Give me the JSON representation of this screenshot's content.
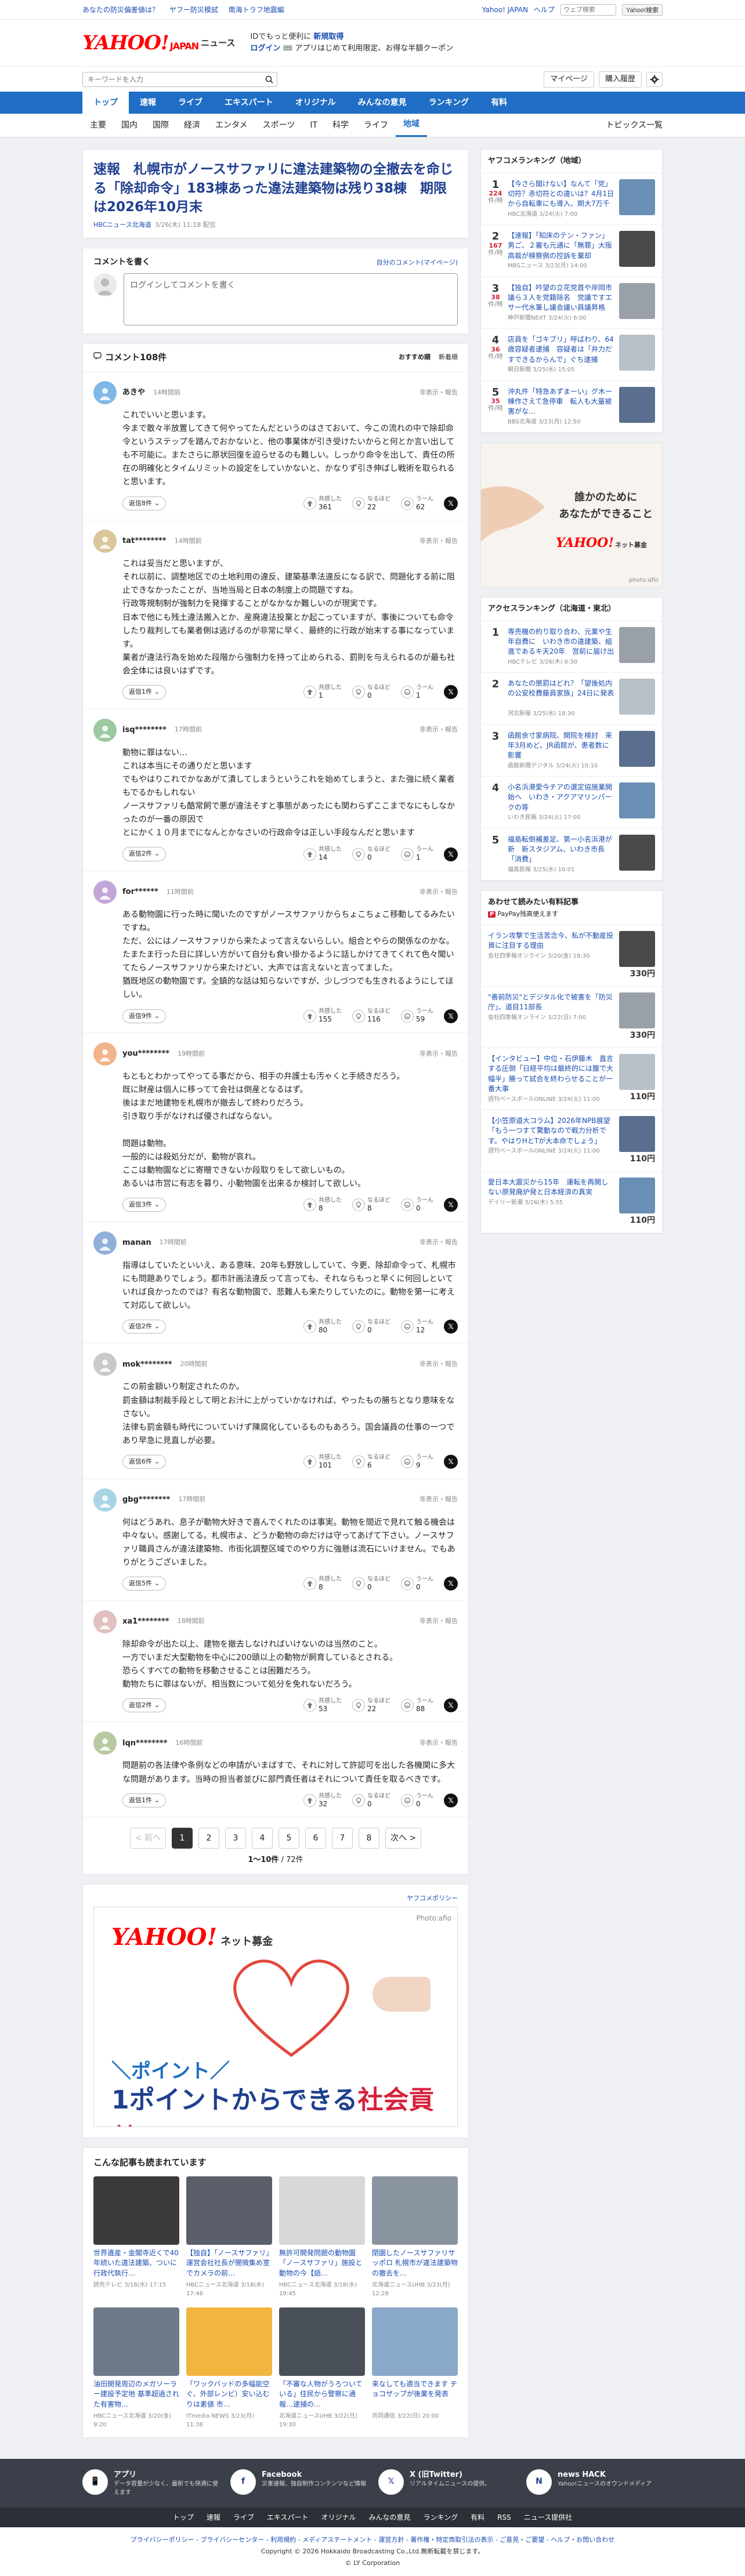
{
  "topstrip": {
    "links": [
      "あなたの防災偏差値は？",
      "ヤフー防災模試",
      "南海トラフ地震編"
    ],
    "right": [
      "Yahoo! JAPAN",
      "ヘルプ"
    ],
    "search_placeholder": "ウェブ検索",
    "search_button": "Yahoo!検索"
  },
  "header": {
    "logo": "YAHOO!",
    "logo_sub": "JAPAN",
    "service": "ニュース",
    "promo1a": "IDでもっと便利に",
    "promo1b": "新規取得",
    "promo2a": "ログイン",
    "promo2b": "アプリはじめて利用限定、お得な半額クーポン"
  },
  "searchrow": {
    "placeholder": "キーワードを入力",
    "mypage": "マイページ",
    "purchase": "購入履歴"
  },
  "nav1": [
    "トップ",
    "速報",
    "ライブ",
    "エキスパート",
    "オリジナル",
    "みんなの意見",
    "ランキング",
    "有料"
  ],
  "nav2": [
    "主要",
    "国内",
    "国際",
    "経済",
    "エンタメ",
    "スポーツ",
    "IT",
    "科学",
    "ライフ",
    "地域"
  ],
  "nav2_topics": "トピックス一覧",
  "article": {
    "title": "速報　札幌市がノースサファリに違法建築物の全撤去を命じる「除却命令」183棟あった違法建築物は残り38棟　期限は2026年10月末",
    "source": "HBCニュース北海道",
    "date": "3/26(木) 11:18 配信"
  },
  "comment_write": {
    "title": "コメントを書く",
    "profile_link": "自分のコメント(マイページ)",
    "box_text": "ログインしてコメントを書く"
  },
  "comments_head": {
    "title": "コメント108件",
    "sort1": "おすすめ順",
    "sort2": "新着順"
  },
  "reply_label": "返信",
  "report_label": "非表示・報告",
  "react_labels": [
    "共感した",
    "なるほど",
    "うーん"
  ],
  "comments": [
    {
      "user": "あきや",
      "time": "14時間前",
      "body": "これでいいと思います。\n今まで散々半放置してきて何やってたんだというのはさておいて、今この流れの中で除却命令というステップを踏んでおかないと、他の事業体が引き受けたいからと何とか言い出しても不可能に。またさらに原状回復を迫らせるのも難しい。しっかり命令を出して、責任の所在の明確化とタイムリミットの設定をしていかないと、かなりず引き伸ばし戦術を取られると思います。",
      "replies": "返信8件",
      "r": [
        361,
        22,
        62
      ]
    },
    {
      "user": "tat********",
      "time": "14時間前",
      "body": "これは妥当だと思いますが、\nそれ以前に、調整地区での土地利用の違反、建築基準法違反になる訳で、問題化する前に阻止できなかったことが、当地当局と日本の制度上の問題ですね。\n行政等規制制が強制力を発揮することがなかなか難しいのが現実です。\n日本で他にも残土違法搬入とか、産廃違法投棄とか起こっていますが、事後についても命令したり裁判しても業者側は逃げるのが非常に早く、最終的に行政が始末する事になっています。\n業者が違法行為を始めた段階から強制力を持って止められる、罰則を与えられるのが最も社会全体には良いはずです。",
      "replies": "返信1件",
      "r": [
        1,
        0,
        1
      ]
    },
    {
      "user": "isq********",
      "time": "17時間前",
      "body": "動物に罪はない…\nこれは本当にその通りだと思います\nでもやはりこれでかなあがて潰してしまうというこれを始めてしまうと、また強に続く業者もでるかもしれない\nノースサファリも酷常飼で悪が違法そすと事態があったにも関わらずここまでなにもしなかったのが一番の原因で\nとにかく１０月までになんとかなさいの行政命令は正しい手段なんだと思います",
      "replies": "返信2件",
      "r": [
        14,
        0,
        1
      ]
    },
    {
      "user": "for******",
      "time": "11時間前",
      "body": "ある動物園に行った時に聞いたのですがノースサファリからちょこちょこ移動してるみたいですね。\nただ、公にはノースサファリから来たよって言えないらしい。組合とやらの関係なのかな。\nたまたま行った日に詳しい方がいて自分も食い掛かるように話しかけてきてくれて色々聞いてたらノースサファリから来たけどい、大声では言えないと言ってました。\n猶既地区の動物園です。全鎮的な話は知らないですが、少しづつでも生きれるようにしてほしい。",
      "replies": "返信9件",
      "r": [
        155,
        116,
        59
      ]
    },
    {
      "user": "you********",
      "time": "19時間前",
      "body": "もともとわかってやってる事だから、相手の弁護士も汚ゃくと手続きだろう。\n既に財産は個人に移ってて会社は倒産となるはず。\n後はまだ地建物を札幌市が撤去して終わりだろう。\n引き取り手がなければ優さればならない。\n\n問題は動物。\n一般的には殺処分だが、動物が哀れ。\nここは動物園などに寄贈できないか段取りをして欲しいもの。\nあるいは市営に有志を募り、小動物園を出来るか検討して欲しい。",
      "replies": "返信3件",
      "r": [
        8,
        8,
        0
      ]
    },
    {
      "user": "manan",
      "time": "17時間前",
      "body": "指導はしていたといいえ、ある意味、20年も野放ししていて、今更、除却命令って、札幌市にも問題ありでしょう。都市計画法違反って言っても、それならもっと早くに何回しといていれば良かったのでは？有名な動物園で、悲難人も来たりしていたのに。動物を第一に考えて対応して欲しい。",
      "replies": "返信2件",
      "r": [
        80,
        0,
        12
      ]
    },
    {
      "user": "mok********",
      "time": "20時間前",
      "body": "この前金額いり制定されたのか。\n罰金額は制裁手段として明とお汁に上がっていかなければ、やったもの勝ちとなり意味をなさない。\n法律も罰金額も時代についていけず陳腐化しているものもあろう。国会議員の仕事の一つであり早急に見直しが必要。",
      "replies": "返信6件",
      "r": [
        101,
        6,
        9
      ]
    },
    {
      "user": "gbg********",
      "time": "17時間前",
      "body": "何はどうあれ、息子が動物大好きで喜んでくれたのは事実。動物を間近で見れて触る機会は中々ない。感謝してる。札幌市よ、どうか動物の命だけは守ってあげて下さい。ノースサファリ職員さんが違法建築物、市街化調整区域でのやり方に強懸は流石にいけません。でもありがとうございました。",
      "replies": "返信5件",
      "r": [
        8,
        0,
        0
      ]
    },
    {
      "user": "xa1********",
      "time": "18時間前",
      "body": "除却命令が出た以上、建物を撤去しなければいけないのは当然のこと。\n一方でいまだ大型動物を中心に200頭以上の動物が飼育しているとされる。\n恐らくすべての動物を移動させることは困難だろう。\n動物たちに罪はないが、相当数について処分を免れないだろう。",
      "replies": "返信2件",
      "r": [
        53,
        22,
        88
      ]
    },
    {
      "user": "lqn********",
      "time": "16時間前",
      "body": "問題前の各法律や条例などの申請がいまばすで、それに対して許認可を出した各機関に多大な問題があります。当時の担当者並びに部門責任者はそれについて責任を取るべきです。",
      "replies": "返信1件",
      "r": [
        32,
        0,
        0
      ]
    }
  ],
  "pager": {
    "prev": "< 前へ",
    "next": "次へ >",
    "pages": [
      "1",
      "2",
      "3",
      "4",
      "5",
      "6",
      "7",
      "8"
    ],
    "count_bold": "1〜10件",
    "count_rest": " / 72件"
  },
  "ad": {
    "policy": "ヤフコメポリシー",
    "logo": "YAHOO!",
    "logo_sub": "JAPAN",
    "logo_tag": "ネット募金",
    "photo": "Photo:afio",
    "line1": "＼ポイント／",
    "line2a": "1ポイントからできる",
    "line2b": "社会貢献"
  },
  "related": {
    "title": "こんな記事も読まれています",
    "items": [
      {
        "t": "世界遺産・金閣寺近くで40年続いた違法建築、ついに行政代執行…",
        "s": "読売テレビ",
        "d": "3/18(水) 17:15"
      },
      {
        "t": "【独自】「ノースサファリ」運営会社社長が闇微集め室でカメラの前…",
        "s": "HBCニュース北海道",
        "d": "3/18(水) 17:46"
      },
      {
        "t": "無許可開発問題の動物園「ノースサファリ」施設と動物の今【語…",
        "s": "HBCニュース北海道",
        "d": "3/18(水) 19:45"
      },
      {
        "t": "閉園したノースサファリサッポロ 札幌市が違法建築物の撤去を…",
        "s": "北海道ニュースUHB",
        "d": "3/23(月) 12:28"
      },
      {
        "t": "油田開発周辺のメガソーラー建設予定地 基準超過された有害物…",
        "s": "HBCニュース北海道",
        "d": "3/20(金) 9:20"
      },
      {
        "t": "「ワックバッドの多幅能空ぐ、外部レンビ）安い込むりは素値 市…",
        "s": "ITmedia NEWS",
        "d": "3/23(月) 11:38"
      },
      {
        "t": "「不審な人物がうろついている」住民から警察に通報…逮捕の…",
        "s": "北海道ニュースUHB",
        "d": "3/22(日) 19:30"
      },
      {
        "t": "来なしても適当できます チョコザップが後業を発表",
        "s": "共同通信",
        "d": "3/22(日) 20:00"
      }
    ]
  },
  "side": {
    "rank_title": "ヤフコメランキング（地域）",
    "rank": [
      {
        "n": "1",
        "c": "224",
        "u": "件/時",
        "t": "【今さら聞けない】なんて「党」切符？赤切符との違いは？4月1日から自転車にも導入、期大7万千円の反則金",
        "s": "HBC北海道 3/24(火) 7:00"
      },
      {
        "n": "2",
        "c": "167",
        "u": "件/時",
        "t": "【速報】「知床のテン・ファン」男ご、２審も元通に「無罪」大阪高裁が検察側の控訴を棄却",
        "s": "MBSニュース 3/23(月) 14:00"
      },
      {
        "n": "3",
        "c": "38",
        "u": "件/時",
        "t": "【独自】吟望の立花党首や岸岡市議ら３人を党籍除名　党議ですエサー代水筆し議会議い員議昇格",
        "s": "神戸新聞NEXT 3/24(火) 6:00"
      },
      {
        "n": "4",
        "c": "36",
        "u": "件/時",
        "t": "店員を「ゴキブリ」呼ばわり、64歳容疑者逮捕　容疑者は「弁力だすできるからんで」ぐち逮捕",
        "s": "朝日新聞 3/25(水) 15:05"
      },
      {
        "n": "5",
        "c": "35",
        "u": "件/時",
        "t": "沖丸件「特急あずまーい」グ木ー棟作さえて急停車　転人も大量被害がな…",
        "s": "BBS北海道 3/23(月) 12:50"
      }
    ],
    "sad_msg1": "誰かのために",
    "sad_msg2": "あなたができること",
    "sad_logo": "YAHOO!",
    "sad_logo_sub": "ネット募金",
    "sad_photo": "photo:afio",
    "access_title": "アクセスランキング（北海道・東北）",
    "access": [
      {
        "n": "1",
        "t": "専売機の約り取り合わ、元業や生年自費に　いわき市の違建築、組進であるキ天20年　営前に届け出定",
        "s": "HBCテレビ 3/26(木) 6:30"
      },
      {
        "n": "2",
        "t": "あなたの懲罰はどれ？「望後処内の公安校費藤員家族」24日に発表",
        "s": "河北新報 3/25(水) 18:30"
      },
      {
        "n": "3",
        "t": "函館余寸家病院、開院を検討　来年3月めど、JR函館が、患者数に影響",
        "s": "函館新聞デジタル 3/24(火) 10:10"
      },
      {
        "n": "4",
        "t": "小名浜港愛今チアの選定協施業開始へ　いわき・アクアマリンパークの等",
        "s": "いわき民報 3/24(火) 17:00"
      },
      {
        "n": "5",
        "t": "福島転倒補差足、第一小名浜港が新　新スタジアム、いわき市長「消費」",
        "s": "福島民報 3/25(水) 10:01"
      }
    ],
    "shop_title": "あわせて読みたい有料記事",
    "shop_pp": "PayPay残高",
    "shop_pp_rest": "使えます",
    "shop": [
      {
        "t": "イラン攻撃で生活苦念今、私が不動産投資に注目する理由",
        "s": "会社四季報オンライン 3/20(金) 18:30",
        "p": "330円"
      },
      {
        "t": "\"善前防災\"とデジタル化で被害を「防災庁」、道目11部長",
        "s": "会社四季報オンライン 3/22(日) 7:00",
        "p": "330円"
      },
      {
        "t": "【インタビュー】中位・石伊藤木　直言する圧倒「日経平均は最終的には腹で大幅半」勝って試合を終わらせることが一番大事",
        "s": "週刊ベースボールONLINE 3/24(火) 11:00",
        "p": "110円"
      },
      {
        "t": "【小笠原道大コラム】2026年NPB展望「もう一つすて驚動なので戦力分析です。やはりHとTが大本命でしょう」",
        "s": "週刊ベースボールONLINE 3/24(火) 11:00",
        "p": "110円"
      },
      {
        "t": "愛日本大震災から15年　運転を再開しない原発廃炉発と日本経済の真実",
        "s": "デイリー新潮 3/26(木) 5:55",
        "p": "110円"
      }
    ]
  },
  "footer": {
    "apps": [
      {
        "t": "アプリ",
        "d": "データ容量が少なく、最新でも快適に使えます"
      },
      {
        "t": "Facebook",
        "d": "災害速報、独自制作コンテンツなど情報"
      },
      {
        "t": "X (旧Twitter)",
        "d": "リアルタイムニュースの提供。"
      },
      {
        "t": "news HACK",
        "d": "Yahoo!ニュースのオウンドメディア"
      }
    ],
    "nav": [
      "トップ",
      "速報",
      "ライブ",
      "エキスパート",
      "オリジナル",
      "みんなの意見",
      "ランキング",
      "有料",
      "RSS",
      "ニュース提供社"
    ],
    "links": "プライバシーポリシー - プライバシーセンター - 利用規約 - メディアステートメント - 運営方針 - 著作権・特定商取引法の表示 - ご意見・ご要望 - ヘルプ・お問い合わせ",
    "copy1": "Copyright © 2026 Hokkaido Broadcasting Co.,Ltd.無断転載を禁じます。",
    "copy2": "© LY Corporation"
  }
}
